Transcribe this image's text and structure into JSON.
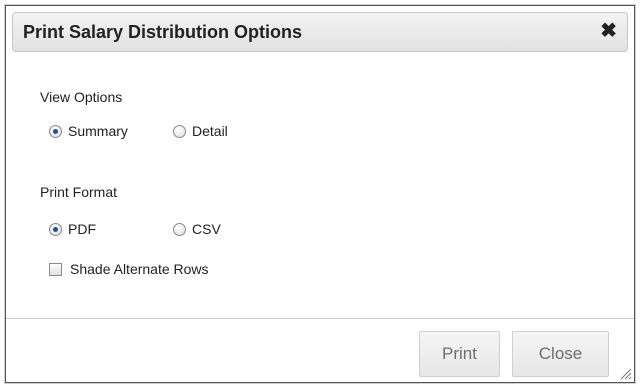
{
  "dialog": {
    "title": "Print Salary Distribution Options",
    "close_glyph": "✖",
    "view_options": {
      "label": "View Options",
      "options": [
        {
          "label": "Summary",
          "checked": true
        },
        {
          "label": "Detail",
          "checked": false
        }
      ]
    },
    "print_format": {
      "label": "Print Format",
      "options": [
        {
          "label": "PDF",
          "checked": true
        },
        {
          "label": "CSV",
          "checked": false
        }
      ]
    },
    "shade_rows": {
      "label": "Shade Alternate Rows",
      "checked": false
    },
    "buttons": {
      "print": "Print",
      "close": "Close"
    }
  },
  "colors": {
    "radio_selected": "#1c4fa6",
    "button_text": "#6e6e6e",
    "title_bar": "#e2e2e2"
  },
  "icons": [
    "close-icon",
    "resize-grip-icon"
  ]
}
